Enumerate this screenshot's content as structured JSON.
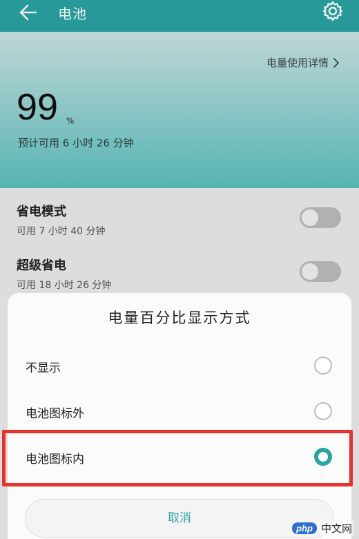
{
  "top_bar": {
    "title": "电池",
    "back_icon": "back-arrow-icon",
    "settings_icon": "gear-icon",
    "color": "#2aa3a3"
  },
  "header": {
    "usage_link": "电量使用详情",
    "battery_percent": "99",
    "percent_sign": "%",
    "estimate": "预计可用 6 小时 26 分钟"
  },
  "settings": [
    {
      "title": "省电模式",
      "subtitle": "可用 7 小时 40 分钟",
      "enabled": false
    },
    {
      "title": "超级省电",
      "subtitle": "可用 18 小时 26 分钟",
      "enabled": false
    }
  ],
  "dialog": {
    "title": "电量百分比显示方式",
    "options": [
      {
        "label": "不显示",
        "selected": false
      },
      {
        "label": "电池图标外",
        "selected": false
      },
      {
        "label": "电池图标内",
        "selected": true
      }
    ],
    "cancel_label": "取消",
    "accent_color": "#2aa3a3",
    "highlight_color": "#e8322f"
  },
  "watermark": {
    "badge": "php",
    "text": "中文网"
  }
}
